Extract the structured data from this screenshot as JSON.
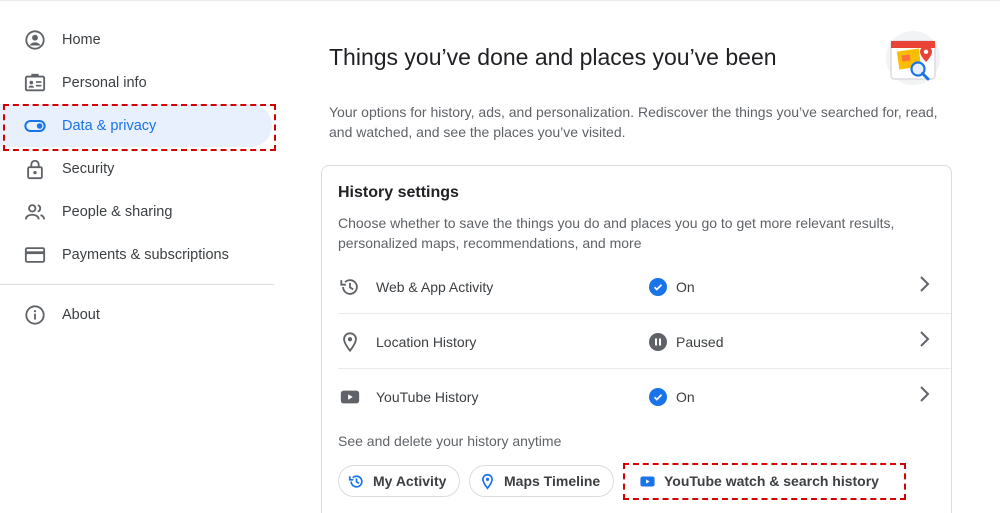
{
  "sidebar": {
    "items": [
      {
        "label": "Home",
        "icon": "account-circle-icon"
      },
      {
        "label": "Personal info",
        "icon": "badge-icon"
      },
      {
        "label": "Data & privacy",
        "icon": "toggle-icon",
        "active": true
      },
      {
        "label": "Security",
        "icon": "lock-icon"
      },
      {
        "label": "People & sharing",
        "icon": "people-icon"
      },
      {
        "label": "Payments & subscriptions",
        "icon": "credit-card-icon"
      }
    ],
    "about": {
      "label": "About",
      "icon": "info-icon"
    }
  },
  "main": {
    "title": "Things you’ve done and places you’ve been",
    "description": "Your options for history, ads, and personalization. Rediscover the things you’ve searched for, read, and watched, and see the places you’ve visited.",
    "illustration": "history-illustration"
  },
  "history_settings": {
    "title": "History settings",
    "description": "Choose whether to save the things you do and places you go to get more relevant results, personalized maps, recommendations, and more",
    "rows": [
      {
        "label": "Web & App Activity",
        "status": "On",
        "icon": "history-icon",
        "status_icon": "check-circle-icon"
      },
      {
        "label": "Location History",
        "status": "Paused",
        "icon": "location-pin-icon",
        "status_icon": "pause-circle-icon"
      },
      {
        "label": "YouTube History",
        "status": "On",
        "icon": "youtube-icon",
        "status_icon": "check-circle-icon"
      }
    ],
    "see_delete_label": "See and delete your history anytime",
    "chips": [
      {
        "label": "My Activity",
        "icon": "history-icon"
      },
      {
        "label": "Maps Timeline",
        "icon": "location-pin-icon"
      },
      {
        "label": "YouTube watch & search history",
        "icon": "youtube-icon"
      }
    ]
  },
  "colors": {
    "accent": "#1a73e8",
    "active_bg": "#e8f0fe",
    "annotation": "#d50000",
    "text_secondary": "#5f6368"
  }
}
